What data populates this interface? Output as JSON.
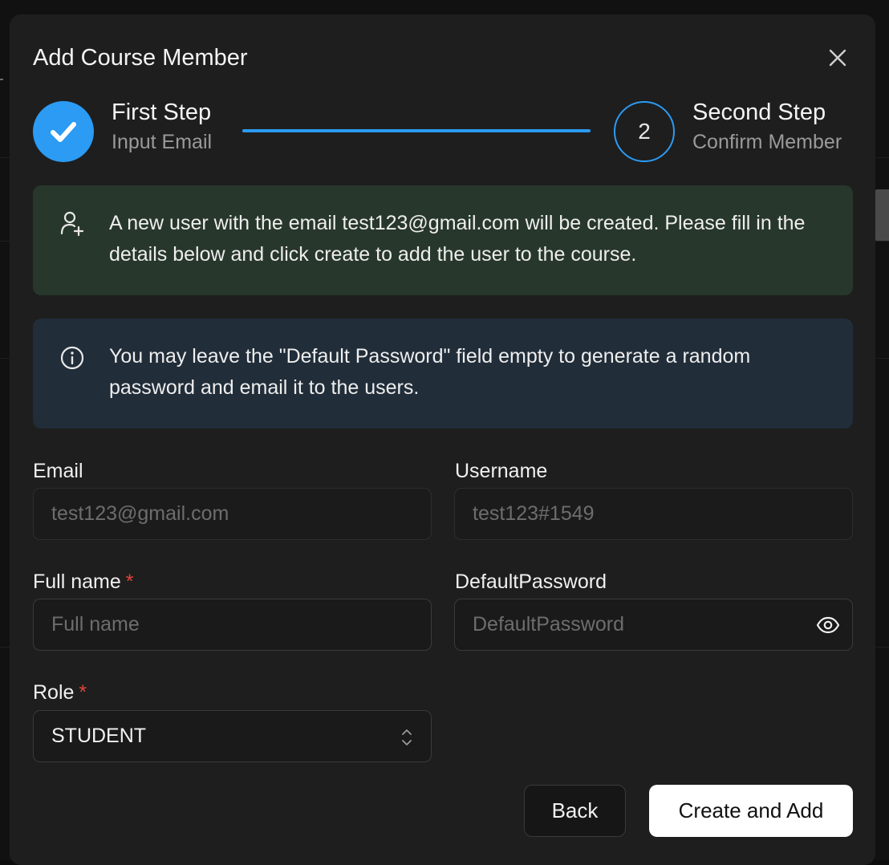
{
  "dialog": {
    "title": "Add Course Member",
    "close_icon": "close-icon"
  },
  "stepper": {
    "steps": [
      {
        "title": "First Step",
        "subtitle": "Input Email",
        "status": "completed",
        "icon": "checkmark-icon"
      },
      {
        "title": "Second Step",
        "subtitle": "Confirm Member",
        "status": "active",
        "number": "2"
      }
    ],
    "accent_color": "#2b9bf4"
  },
  "alerts": {
    "success": {
      "icon": "user-plus-icon",
      "text": "A new user with the email test123@gmail.com will be created. Please fill in the details below and click create to add the user to the course."
    },
    "info": {
      "icon": "info-circle-icon",
      "text": "You may leave the \"Default Password\" field empty to generate a random password and email it to the users."
    }
  },
  "form": {
    "email": {
      "label": "Email",
      "value": "",
      "placeholder": "test123@gmail.com",
      "disabled": true
    },
    "username": {
      "label": "Username",
      "value": "",
      "placeholder": "test123#1549",
      "disabled": true
    },
    "full_name": {
      "label": "Full name",
      "required_mark": "*",
      "value": "",
      "placeholder": "Full name"
    },
    "default_password": {
      "label": "DefaultPassword",
      "value": "",
      "placeholder": "DefaultPassword",
      "toggle_icon": "eye-icon"
    },
    "role": {
      "label": "Role",
      "required_mark": "*",
      "value": "STUDENT",
      "icon": "chevron-up-down-icon"
    }
  },
  "actions": {
    "back_label": "Back",
    "create_label": "Create and Add"
  }
}
